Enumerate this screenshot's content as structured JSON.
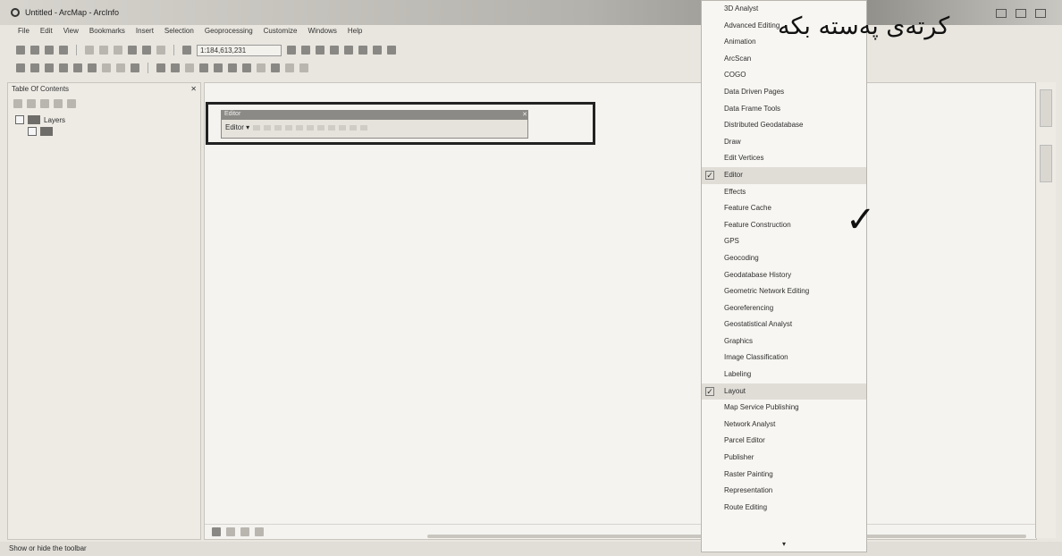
{
  "window": {
    "title": "Untitled - ArcMap - ArcInfo"
  },
  "menubar": [
    "File",
    "Edit",
    "View",
    "Bookmarks",
    "Insert",
    "Selection",
    "Geoprocessing",
    "Customize",
    "Windows",
    "Help"
  ],
  "toolbar": {
    "scale_value": "1:184,613,231"
  },
  "toc": {
    "title": "Table Of Contents",
    "layers_label": "Layers"
  },
  "editor_toolbar": {
    "title": "Editor",
    "editor_button": "Editor ▾"
  },
  "toolbars_menu": {
    "items": [
      {
        "label": "3D Analyst",
        "checked": false
      },
      {
        "label": "Advanced Editing",
        "checked": false
      },
      {
        "label": "Animation",
        "checked": false
      },
      {
        "label": "ArcScan",
        "checked": false
      },
      {
        "label": "COGO",
        "checked": false
      },
      {
        "label": "Data Driven Pages",
        "checked": false
      },
      {
        "label": "Data Frame Tools",
        "checked": false
      },
      {
        "label": "Distributed Geodatabase",
        "checked": false
      },
      {
        "label": "Draw",
        "checked": false
      },
      {
        "label": "Edit Vertices",
        "checked": false
      },
      {
        "label": "Editor",
        "checked": true
      },
      {
        "label": "Effects",
        "checked": false
      },
      {
        "label": "Feature Cache",
        "checked": false
      },
      {
        "label": "Feature Construction",
        "checked": false
      },
      {
        "label": "GPS",
        "checked": false
      },
      {
        "label": "Geocoding",
        "checked": false
      },
      {
        "label": "Geodatabase History",
        "checked": false
      },
      {
        "label": "Geometric Network Editing",
        "checked": false
      },
      {
        "label": "Georeferencing",
        "checked": false
      },
      {
        "label": "Geostatistical Analyst",
        "checked": false
      },
      {
        "label": "Graphics",
        "checked": false
      },
      {
        "label": "Image Classification",
        "checked": false
      },
      {
        "label": "Labeling",
        "checked": false
      },
      {
        "label": "Layout",
        "checked": true
      },
      {
        "label": "Map Service Publishing",
        "checked": false
      },
      {
        "label": "Network Analyst",
        "checked": false
      },
      {
        "label": "Parcel Editor",
        "checked": false
      },
      {
        "label": "Publisher",
        "checked": false
      },
      {
        "label": "Raster Painting",
        "checked": false
      },
      {
        "label": "Representation",
        "checked": false
      },
      {
        "label": "Route Editing",
        "checked": false
      }
    ],
    "more_arrow": "▾"
  },
  "annotation": {
    "text": "کرتەی پەستە بکە",
    "checkmark": "✓"
  },
  "status_bar": {
    "text": "Show or hide the toolbar"
  }
}
